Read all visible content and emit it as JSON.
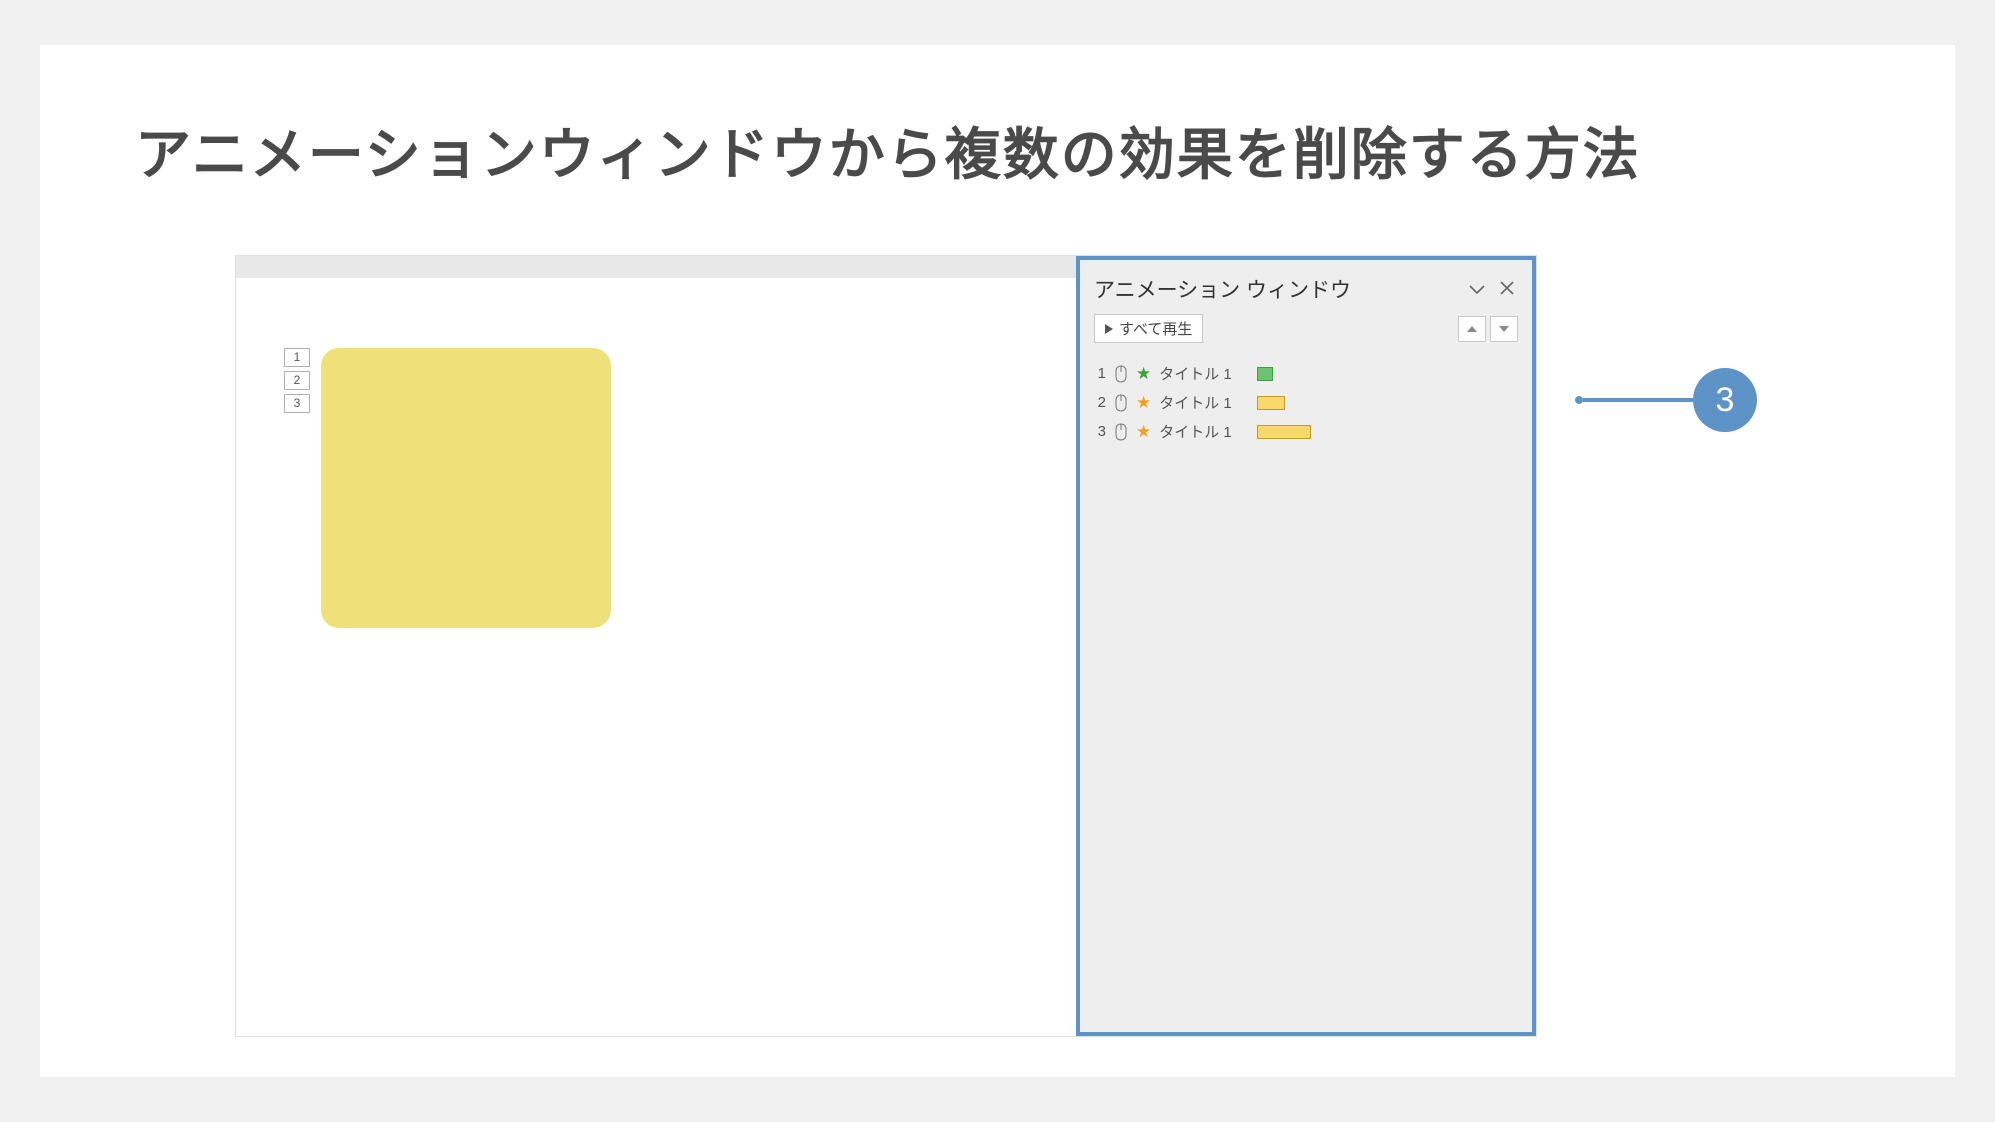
{
  "heading": "アニメーションウィンドウから複数の効果を削除する方法",
  "slide": {
    "tags": [
      "1",
      "2",
      "3"
    ],
    "shape_color": "#efe07a"
  },
  "pane": {
    "title": "アニメーション ウィンドウ",
    "play_all": "すべて再生",
    "items": [
      {
        "num": "1",
        "star": "green",
        "label": "タイトル 1",
        "width": 16
      },
      {
        "num": "2",
        "star": "orange",
        "label": "タイトル 1",
        "width": 28
      },
      {
        "num": "3",
        "star": "orange",
        "label": "タイトル 1",
        "width": 54
      }
    ]
  },
  "callout": {
    "number": "3"
  }
}
